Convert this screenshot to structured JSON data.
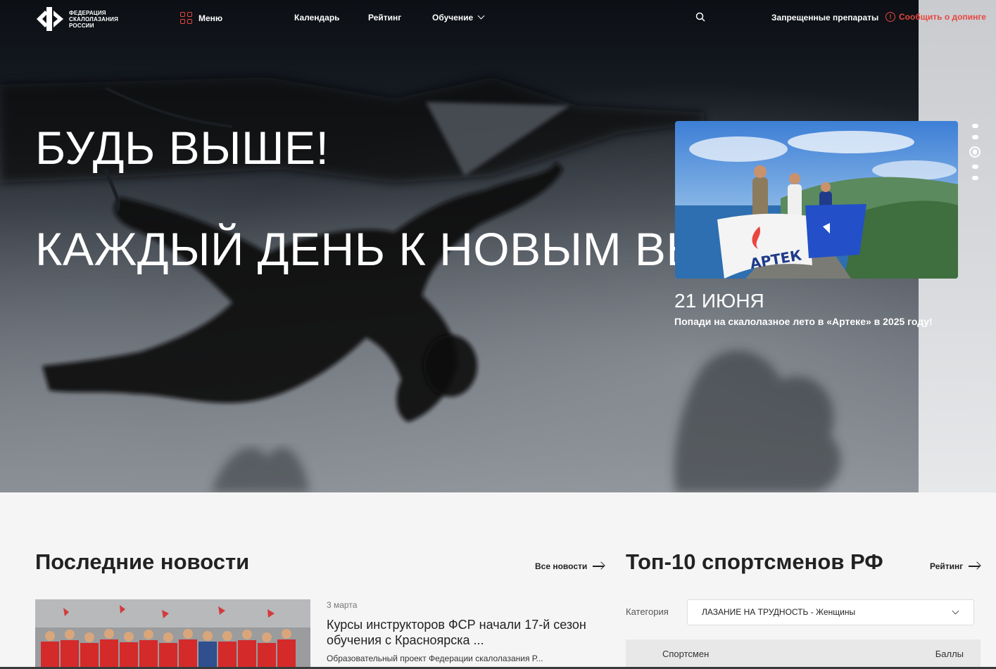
{
  "brand": {
    "logo_text": "ФЕДЕРАЦИЯ СКАЛОЛАЗАНИЯ РОССИИ"
  },
  "nav": {
    "menu_label": "Меню",
    "calendar_label": "Календарь",
    "rating_label": "Рейтинг",
    "education_label": "Обучение",
    "forbidden_label": "Запрещенные препараты",
    "report_label": "Сообщить о допинге"
  },
  "hero": {
    "title_line1": "БУДЬ ВЫШЕ!",
    "title_line2": "КАЖДЫЙ ДЕНЬ К НОВЫМ ВЫСОТАМ!",
    "slide": {
      "date": "21 ИЮНЯ",
      "description": "Попади на скалолазное лето в «Артеке» в 2025 году!",
      "flag_text": "АРТЕК"
    },
    "slides_count": 5,
    "active_slide": 3
  },
  "news": {
    "section_title": "Последние новости",
    "all_label": "Все новости",
    "item": {
      "date": "3 марта",
      "title": "Курсы инструкторов ФСР начали 17-й сезон обучения с Красноярска ...",
      "subtitle": "Образовательный проект Федерации скалолазания Р..."
    }
  },
  "top10": {
    "section_title": "Топ-10 спортсменов РФ",
    "rating_label": "Рейтинг",
    "category_label": "Категория",
    "category_value": "ЛАЗАНИЕ НА ТРУДНОСТЬ - Женщины",
    "columns": [
      "Спортсмен",
      "Баллы"
    ]
  },
  "colors": {
    "accent": "#e8473f",
    "text": "#222222",
    "bg": "#f5f5f5"
  }
}
